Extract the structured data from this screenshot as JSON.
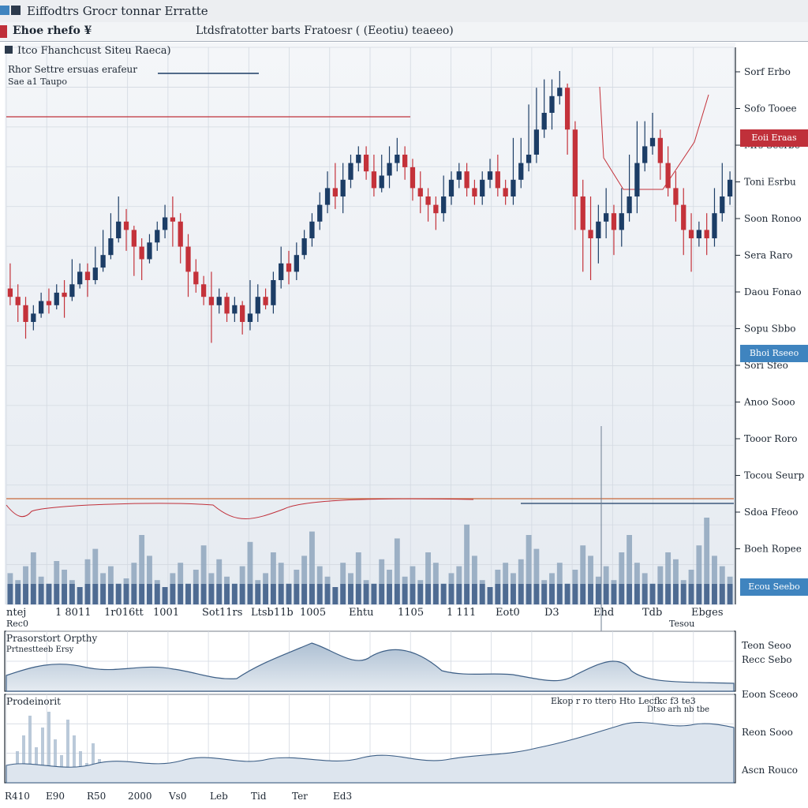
{
  "window": {
    "title": "Eiffodtrs Grocr tonnar Erratte"
  },
  "toolbar": {
    "symbol": "Ehoe rhefo ¥",
    "period": "Ltdsfratotter barts Fratoesr  ( (Eeotiu) teaeeo)"
  },
  "legend": {
    "title": "Itco Fhanchcust Siteu Raeca)",
    "line1": "Rhor Settre ersuas erafeur",
    "line2": "Sae a1 Taupo"
  },
  "indicator_panel_1": {
    "title": "Prasorstort Orpthy",
    "subtitle": "Prtnestteeb Ersy"
  },
  "indicator_panel_2": {
    "title": "Prodeinorit",
    "label": "Ekop r ro ttero   Hto  Lecfkc f3  te3",
    "sublabel": "Dtso  arh  nb  tbe"
  },
  "price_tags": {
    "red": "Eoii Eraas",
    "blue1": "Bhoi Rseeo",
    "blue2": "Ecou Seebo"
  },
  "colors": {
    "up": "#1c3d66",
    "down": "#c4323a",
    "volume": "#8ea6bd",
    "area_fill": "#c8d5e2",
    "area_line": "#3d5f86",
    "accent_red": "#c0303a",
    "accent_blue": "#3f84bf"
  },
  "chart_data": {
    "type": "candlestick",
    "y_axis_labels": [
      "Sorf Erbo",
      "Sofo Tooee",
      "Mrs Seerbc",
      "Toni Esrbu",
      "Soon Ronoo",
      "Sera Raro",
      "Daou Fonao",
      "Sopu Sbbo",
      "Sori Sfeo",
      "Anoo Sooo",
      "Tooor Roro",
      "Tocou Seurp",
      "Sdoa Ffeoo",
      "Boeh Ropee"
    ],
    "x_labels": [
      "ntej",
      "1 8011",
      "1r016tt",
      "1001",
      "Sot11rs",
      "Ltsb11b",
      "1005",
      "Ehtu",
      "1105",
      "1 111",
      "Eot0",
      "D3",
      "Ehd",
      "Tdb",
      "Ebges"
    ],
    "x_sub_labels": [
      "Rec0",
      "Tesou"
    ],
    "indicator_1_axis": [
      "Teon Seoo",
      "Recc Sebo"
    ],
    "indicator_2_axis": [
      "Eoon Sceoo",
      "Reon Sooo",
      "Ascn Rouco"
    ],
    "bottom_x_labels": [
      "R410",
      "E90",
      "R50",
      "2000",
      "Vs0",
      "Leb",
      "Tid",
      "Ter",
      "Ed3"
    ],
    "price_min": 0,
    "price_max": 100,
    "ohlc": [
      [
        48,
        46,
        54,
        44
      ],
      [
        46,
        44,
        49,
        40
      ],
      [
        44,
        40,
        46,
        36
      ],
      [
        40,
        42,
        44,
        38
      ],
      [
        42,
        45,
        47,
        41
      ],
      [
        45,
        44,
        48,
        42
      ],
      [
        44,
        47,
        49,
        43
      ],
      [
        47,
        46,
        50,
        41
      ],
      [
        46,
        49,
        55,
        45
      ],
      [
        49,
        52,
        54,
        48
      ],
      [
        52,
        50,
        54,
        46
      ],
      [
        50,
        53,
        58,
        49
      ],
      [
        53,
        56,
        62,
        52
      ],
      [
        56,
        60,
        66,
        55
      ],
      [
        60,
        64,
        70,
        59
      ],
      [
        64,
        62,
        67,
        57
      ],
      [
        62,
        58,
        63,
        51
      ],
      [
        58,
        55,
        60,
        50
      ],
      [
        55,
        59,
        61,
        54
      ],
      [
        59,
        62,
        64,
        57
      ],
      [
        62,
        65,
        68,
        60
      ],
      [
        65,
        64,
        70,
        58
      ],
      [
        64,
        58,
        66,
        54
      ],
      [
        58,
        52,
        61,
        46
      ],
      [
        52,
        49,
        55,
        47
      ],
      [
        49,
        46,
        51,
        44
      ],
      [
        46,
        44,
        52,
        35
      ],
      [
        44,
        46,
        48,
        42
      ],
      [
        46,
        42,
        47,
        40
      ],
      [
        42,
        44,
        46,
        40
      ],
      [
        44,
        40,
        45,
        37
      ],
      [
        40,
        42,
        50,
        38
      ],
      [
        42,
        46,
        49,
        40
      ],
      [
        46,
        44,
        48,
        43
      ],
      [
        44,
        50,
        52,
        42
      ],
      [
        50,
        54,
        58,
        48
      ],
      [
        54,
        52,
        57,
        49
      ],
      [
        52,
        56,
        59,
        50
      ],
      [
        56,
        60,
        62,
        55
      ],
      [
        60,
        64,
        66,
        58
      ],
      [
        64,
        68,
        71,
        62
      ],
      [
        68,
        72,
        76,
        66
      ],
      [
        72,
        70,
        78,
        67
      ],
      [
        70,
        74,
        78,
        66
      ],
      [
        74,
        78,
        80,
        72
      ],
      [
        78,
        80,
        82,
        76
      ],
      [
        80,
        76,
        82,
        74
      ],
      [
        76,
        72,
        80,
        70
      ],
      [
        72,
        75,
        80,
        71
      ],
      [
        75,
        78,
        82,
        72
      ],
      [
        78,
        80,
        84,
        76
      ],
      [
        80,
        77,
        82,
        74
      ],
      [
        77,
        72,
        79,
        69
      ],
      [
        72,
        70,
        76,
        66
      ],
      [
        70,
        68,
        72,
        64
      ],
      [
        68,
        66,
        70,
        62
      ],
      [
        66,
        70,
        75,
        64
      ],
      [
        70,
        74,
        76,
        68
      ],
      [
        74,
        76,
        78,
        72
      ],
      [
        76,
        72,
        78,
        70
      ],
      [
        72,
        70,
        74,
        68
      ],
      [
        70,
        74,
        76,
        68
      ],
      [
        74,
        76,
        79,
        72
      ],
      [
        76,
        72,
        80,
        70
      ],
      [
        72,
        70,
        74,
        68
      ],
      [
        70,
        74,
        84,
        68
      ],
      [
        74,
        78,
        84,
        72
      ],
      [
        78,
        80,
        92,
        76
      ],
      [
        80,
        86,
        96,
        78
      ],
      [
        86,
        90,
        98,
        84
      ],
      [
        90,
        94,
        98,
        86
      ],
      [
        94,
        96,
        100,
        92
      ],
      [
        96,
        86,
        97,
        80
      ],
      [
        86,
        70,
        88,
        62
      ],
      [
        70,
        62,
        74,
        52
      ],
      [
        62,
        60,
        70,
        50
      ],
      [
        60,
        64,
        68,
        54
      ],
      [
        64,
        66,
        72,
        60
      ],
      [
        66,
        62,
        68,
        56
      ],
      [
        62,
        66,
        72,
        58
      ],
      [
        66,
        70,
        80,
        64
      ],
      [
        70,
        78,
        88,
        66
      ],
      [
        78,
        82,
        88,
        76
      ],
      [
        82,
        84,
        90,
        80
      ],
      [
        84,
        78,
        86,
        74
      ],
      [
        78,
        72,
        82,
        70
      ],
      [
        72,
        68,
        76,
        64
      ],
      [
        68,
        62,
        72,
        56
      ],
      [
        62,
        60,
        66,
        52
      ],
      [
        60,
        62,
        64,
        58
      ],
      [
        62,
        60,
        66,
        56
      ],
      [
        60,
        66,
        72,
        58
      ],
      [
        66,
        70,
        78,
        64
      ],
      [
        70,
        74,
        76,
        68
      ]
    ],
    "volume": [
      18,
      14,
      22,
      30,
      16,
      12,
      25,
      20,
      14,
      10,
      26,
      32,
      18,
      22,
      12,
      15,
      24,
      40,
      28,
      14,
      10,
      18,
      24,
      12,
      20,
      34,
      18,
      26,
      16,
      12,
      22,
      36,
      14,
      18,
      30,
      24,
      12,
      20,
      28,
      42,
      22,
      16,
      10,
      24,
      18,
      30,
      14,
      12,
      26,
      20,
      38,
      16,
      22,
      14,
      30,
      24,
      12,
      18,
      22,
      46,
      28,
      14,
      10,
      20,
      24,
      18,
      26,
      40,
      32,
      14,
      18,
      24,
      12,
      20,
      34,
      28,
      16,
      22,
      14,
      30,
      40,
      24,
      18,
      12,
      22,
      30,
      26,
      14,
      20,
      34,
      50,
      28,
      22,
      16
    ]
  }
}
